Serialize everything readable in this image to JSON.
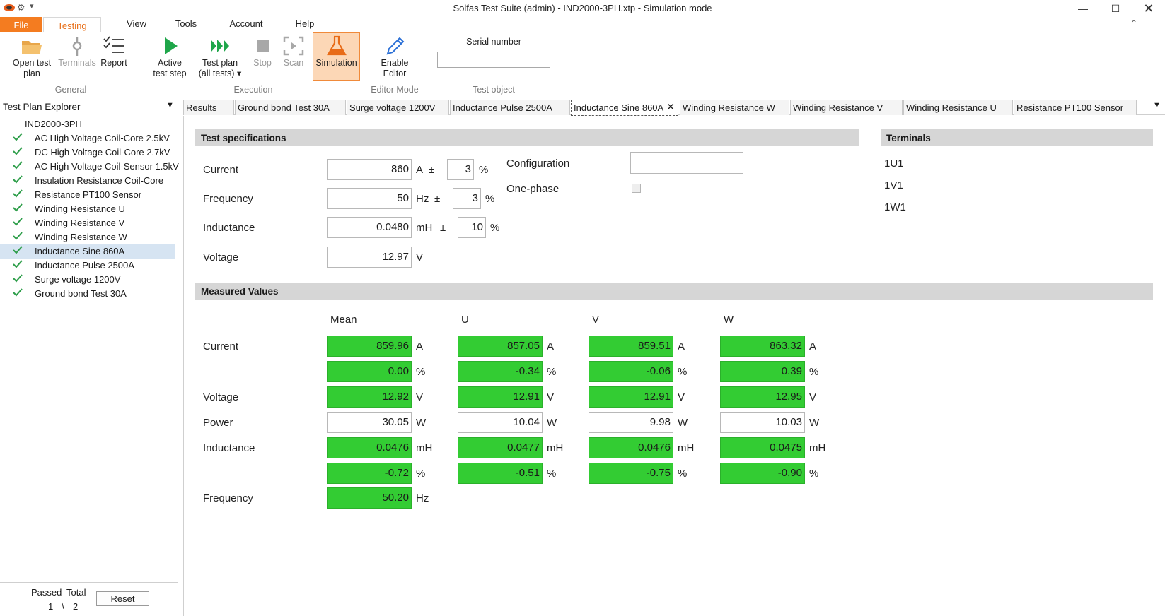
{
  "window": {
    "title": "Solfas Test Suite (admin)  - IND2000-3PH.xtp - Simulation mode"
  },
  "menu": {
    "file": "File",
    "testing": "Testing",
    "view": "View",
    "tools": "Tools",
    "account": "Account",
    "help": "Help"
  },
  "ribbon": {
    "open_test_plan_1": "Open test",
    "open_test_plan_2": "plan",
    "terminals": "Terminals",
    "report": "Report",
    "general": "General",
    "active_step_1": "Active",
    "active_step_2": "test step",
    "test_plan_all_1": "Test plan",
    "test_plan_all_2": "(all tests) ▾",
    "stop": "Stop",
    "scan": "Scan",
    "simulation": "Simulation",
    "execution": "Execution",
    "enable_editor_1": "Enable",
    "enable_editor_2": "Editor",
    "editor_mode": "Editor Mode",
    "serial_number": "Serial number",
    "serial_value": "",
    "test_object": "Test object"
  },
  "explorer": {
    "header": "Test Plan Explorer",
    "root": "IND2000-3PH",
    "items": [
      {
        "label": "AC High Voltage Coil-Core 2.5kV"
      },
      {
        "label": "DC High Voltage Coil-Core 2.7kV"
      },
      {
        "label": "AC High Voltage Coil-Sensor 1.5kV"
      },
      {
        "label": "Insulation Resistance Coil-Core"
      },
      {
        "label": "Resistance PT100 Sensor"
      },
      {
        "label": "Winding Resistance U"
      },
      {
        "label": "Winding Resistance  V"
      },
      {
        "label": "Winding Resistance  W"
      },
      {
        "label": "Inductance Sine 860A"
      },
      {
        "label": "Inductance Pulse 2500A"
      },
      {
        "label": "Surge voltage 1200V"
      },
      {
        "label": "Ground bond Test 30A"
      }
    ],
    "passed_label": "Passed",
    "total_label": "Total",
    "passed_value": "1",
    "sep": "\\",
    "total_value": "2",
    "reset": "Reset"
  },
  "tabs": [
    {
      "label": "Results"
    },
    {
      "label": "Ground bond Test 30A"
    },
    {
      "label": "Surge voltage 1200V"
    },
    {
      "label": "Inductance Pulse 2500A"
    },
    {
      "label": "Inductance Sine 860A"
    },
    {
      "label": "Winding Resistance  W"
    },
    {
      "label": "Winding Resistance  V"
    },
    {
      "label": "Winding Resistance U"
    },
    {
      "label": "Resistance PT100 Sensor"
    }
  ],
  "spec": {
    "title": "Test specifications",
    "current_label": "Current",
    "current_value": "860",
    "current_unit": "A",
    "current_tol": "3",
    "frequency_label": "Frequency",
    "frequency_value": "50",
    "frequency_unit": "Hz",
    "frequency_tol": "3",
    "inductance_label": "Inductance",
    "inductance_value": "0.0480",
    "inductance_unit": "mH",
    "inductance_tol": "10",
    "voltage_label": "Voltage",
    "voltage_value": "12.97",
    "voltage_unit": "V",
    "pm": "±",
    "pct": "%",
    "configuration_label": "Configuration",
    "configuration_value": "",
    "onephase_label": "One-phase"
  },
  "terminals": {
    "title": "Terminals",
    "items": [
      "1U1",
      "1V1",
      "1W1"
    ]
  },
  "measured": {
    "title": "Measured Values",
    "columns": [
      "Mean",
      "U",
      "V",
      "W"
    ],
    "row_labels": {
      "current": "Current",
      "voltage": "Voltage",
      "power": "Power",
      "inductance": "Inductance",
      "frequency": "Frequency"
    },
    "current": [
      "859.96",
      "857.05",
      "859.51",
      "863.32"
    ],
    "current_unit": "A",
    "current_dev": [
      "0.00",
      "-0.34",
      "-0.06",
      "0.39"
    ],
    "pct": "%",
    "voltage": [
      "12.92",
      "12.91",
      "12.91",
      "12.95"
    ],
    "voltage_unit": "V",
    "power": [
      "30.05",
      "10.04",
      "9.98",
      "10.03"
    ],
    "power_unit": "W",
    "inductance": [
      "0.0476",
      "0.0477",
      "0.0476",
      "0.0475"
    ],
    "inductance_unit": "mH",
    "inductance_dev": [
      "-0.72",
      "-0.51",
      "-0.75",
      "-0.90"
    ],
    "frequency": "50.20",
    "frequency_unit": "Hz"
  },
  "colors": {
    "accent": "#f47c20",
    "pass_green": "#33cc33",
    "check_green": "#2e9e4a",
    "selected_row": "#d6e4f2"
  }
}
